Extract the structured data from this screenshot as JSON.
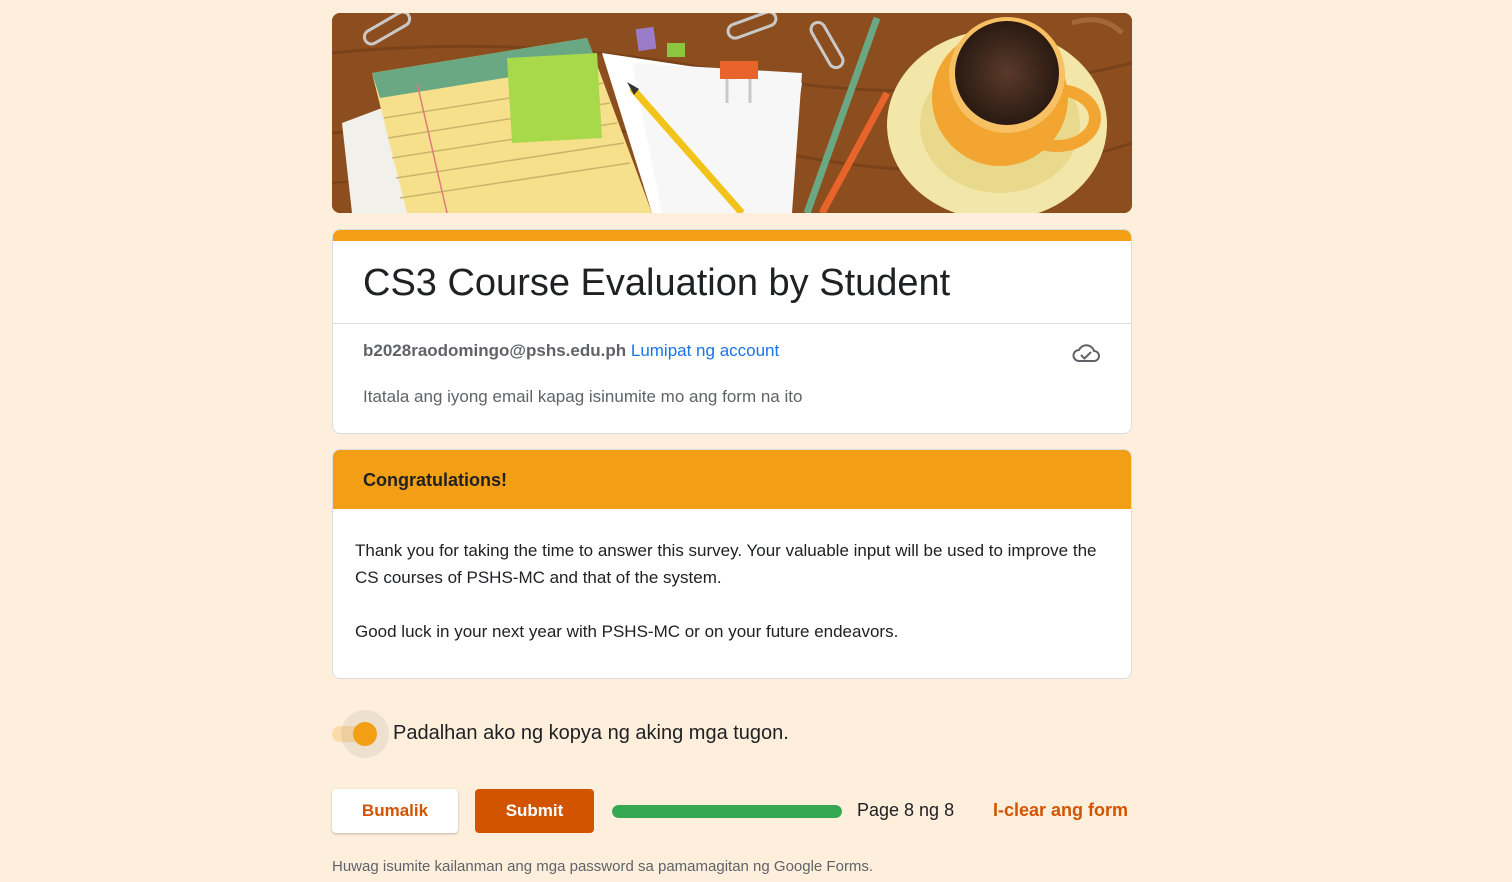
{
  "form": {
    "title": "CS3 Course Evaluation by Student",
    "account_email": "b2028raodomingo@pshs.edu.ph",
    "switch_account": "Lumipat ng account",
    "email_note": "Itatala ang iyong email kapag isinumite mo ang form na ito"
  },
  "section": {
    "title": "Congratulations!",
    "paragraphs": [
      "Thank you for taking the time to answer this survey.  Your valuable input will be used to improve the CS courses of PSHS-MC and that of the system.",
      "Good luck in your next year with PSHS-MC or on your future endeavors."
    ]
  },
  "copy_toggle": {
    "label": "Padalhan ako ng kopya ng aking mga tugon.",
    "on": true
  },
  "actions": {
    "back": "Bumalik",
    "submit": "Submit",
    "page_indicator": "Page 8 ng 8",
    "progress_fraction": 1.0,
    "clear": "I-clear ang form"
  },
  "footer": {
    "note": "Huwag isumite kailanman ang mga password sa pamamagitan ng Google Forms."
  },
  "icons": {
    "save_status": "cloud-done-icon"
  },
  "colors": {
    "page_background": "#fdefdc",
    "theme_orange": "#f29f16",
    "button_orange": "#d35400",
    "progress_green": "#34a853",
    "link_blue": "#1a73e8"
  }
}
